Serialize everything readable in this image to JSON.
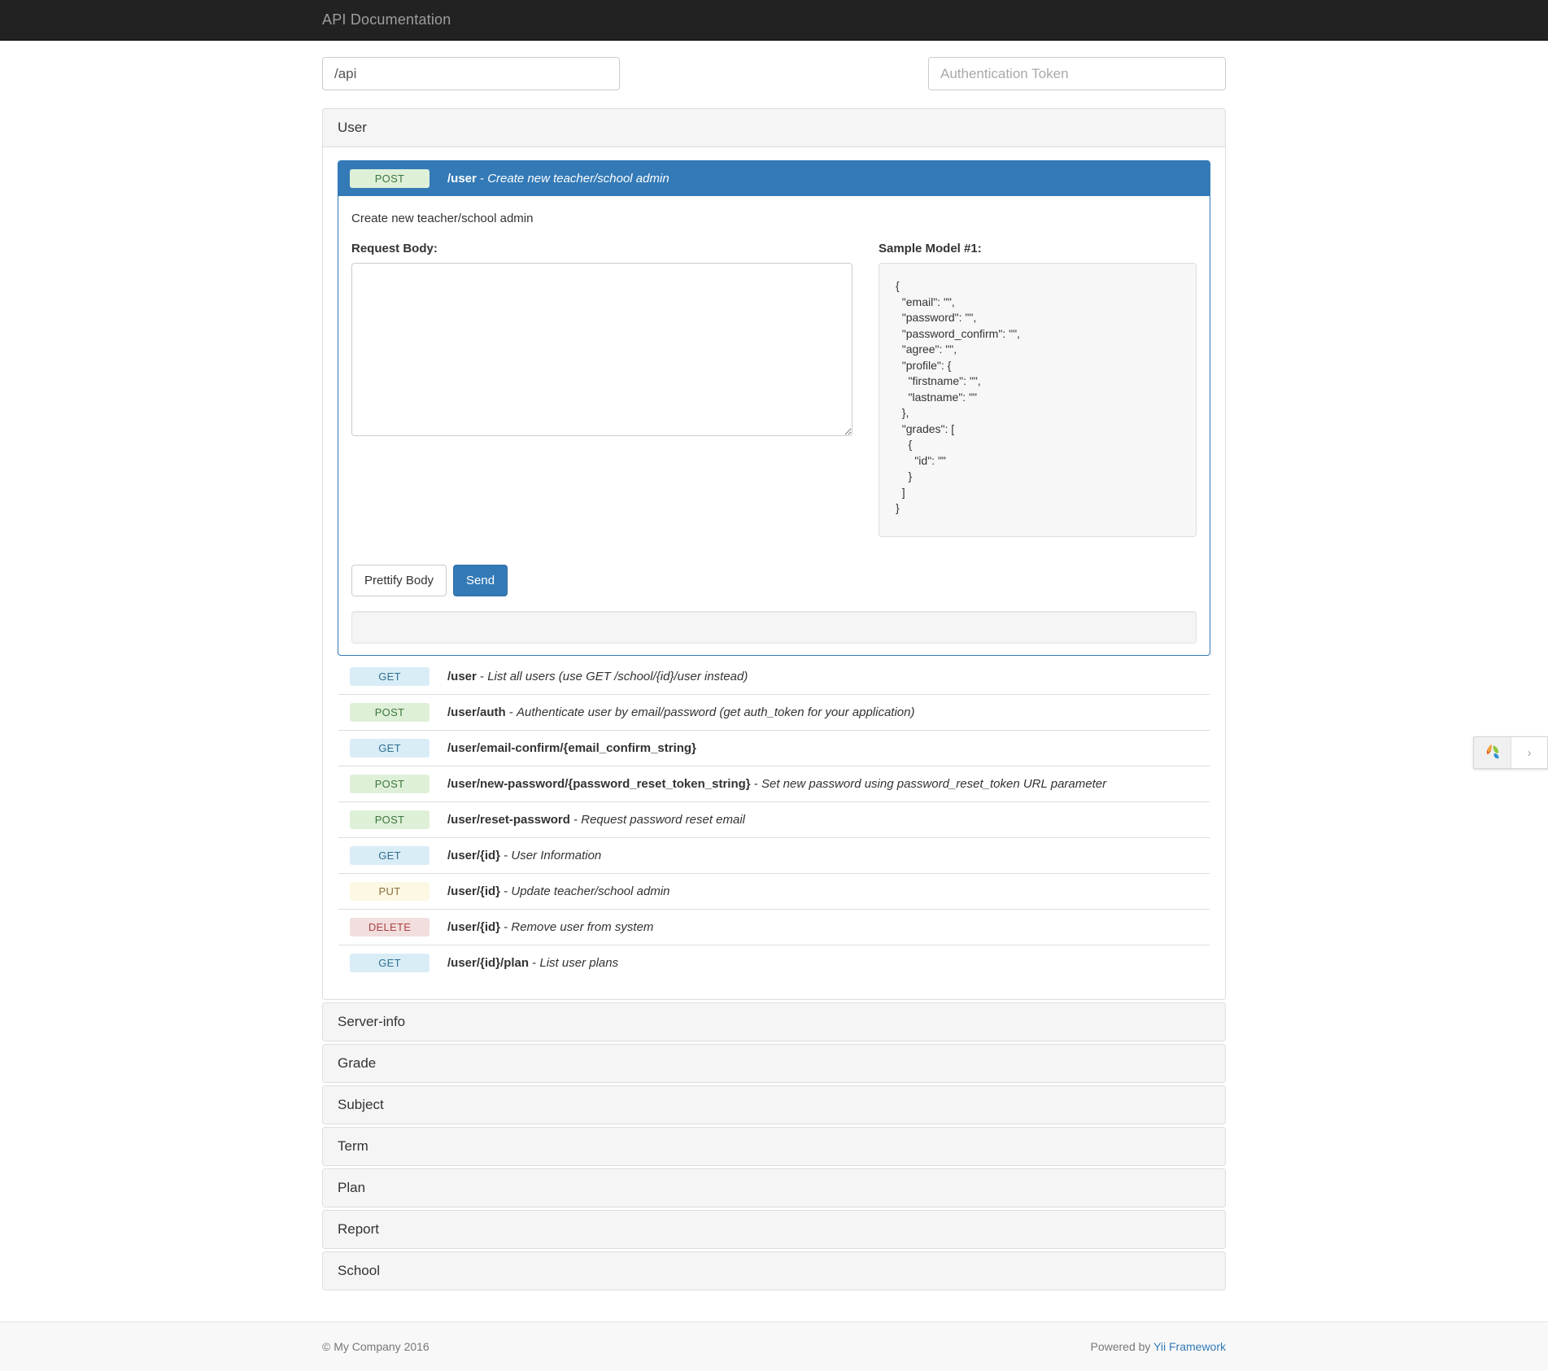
{
  "navbar": {
    "brand": "API Documentation"
  },
  "topbar": {
    "base_path_value": "/api",
    "base_path_placeholder": "/api",
    "auth_token_value": "",
    "auth_token_placeholder": "Authentication Token"
  },
  "sections": [
    {
      "name": "User",
      "expanded": true
    },
    {
      "name": "Server-info",
      "expanded": false
    },
    {
      "name": "Grade",
      "expanded": false
    },
    {
      "name": "Subject",
      "expanded": false
    },
    {
      "name": "Term",
      "expanded": false
    },
    {
      "name": "Plan",
      "expanded": false
    },
    {
      "name": "Report",
      "expanded": false
    },
    {
      "name": "School",
      "expanded": false
    }
  ],
  "active_endpoint": {
    "method": "POST",
    "path": "/user",
    "dash": " - ",
    "summary": "Create new teacher/school admin",
    "description": "Create new teacher/school admin",
    "request_body_label": "Request Body:",
    "request_body_value": "",
    "sample_model_label": "Sample Model #1:",
    "sample_model_json": "{\n  \"email\": \"\",\n  \"password\": \"\",\n  \"password_confirm\": \"\",\n  \"agree\": \"\",\n  \"profile\": {\n    \"firstname\": \"\",\n    \"lastname\": \"\"\n  },\n  \"grades\": [\n    {\n      \"id\": \"\"\n    }\n  ]\n}",
    "prettify_label": "Prettify Body",
    "send_label": "Send",
    "response_value": ""
  },
  "endpoints": [
    {
      "method": "GET",
      "path": "/user",
      "dash": " - ",
      "summary": "List all users (use GET /school/{id}/user instead)"
    },
    {
      "method": "POST",
      "path": "/user/auth",
      "dash": " - ",
      "summary": "Authenticate user by email/password (get auth_token for your application)"
    },
    {
      "method": "GET",
      "path": "/user/email-confirm/{email_confirm_string}",
      "dash": "",
      "summary": ""
    },
    {
      "method": "POST",
      "path": "/user/new-password/{password_reset_token_string}",
      "dash": " - ",
      "summary": "Set new password using password_reset_token URL parameter"
    },
    {
      "method": "POST",
      "path": "/user/reset-password",
      "dash": " - ",
      "summary": "Request password reset email"
    },
    {
      "method": "GET",
      "path": "/user/{id}",
      "dash": " - ",
      "summary": "User Information"
    },
    {
      "method": "PUT",
      "path": "/user/{id}",
      "dash": " - ",
      "summary": "Update teacher/school admin"
    },
    {
      "method": "DELETE",
      "path": "/user/{id}",
      "dash": " - ",
      "summary": "Remove user from system"
    },
    {
      "method": "GET",
      "path": "/user/{id}/plan",
      "dash": " - ",
      "summary": "List user plans"
    }
  ],
  "footer": {
    "copyright": "© My Company 2016",
    "powered_prefix": "Powered by ",
    "powered_link": "Yii Framework"
  },
  "debug_widget": {
    "logo_name": "yii-leaf-logo",
    "toggle_glyph": "›"
  },
  "colors": {
    "primary": "#337ab7",
    "navbar_bg": "#222222",
    "get": "#d9edf7",
    "post": "#dff0d8",
    "put": "#fcf8e3",
    "delete": "#f2dede"
  }
}
